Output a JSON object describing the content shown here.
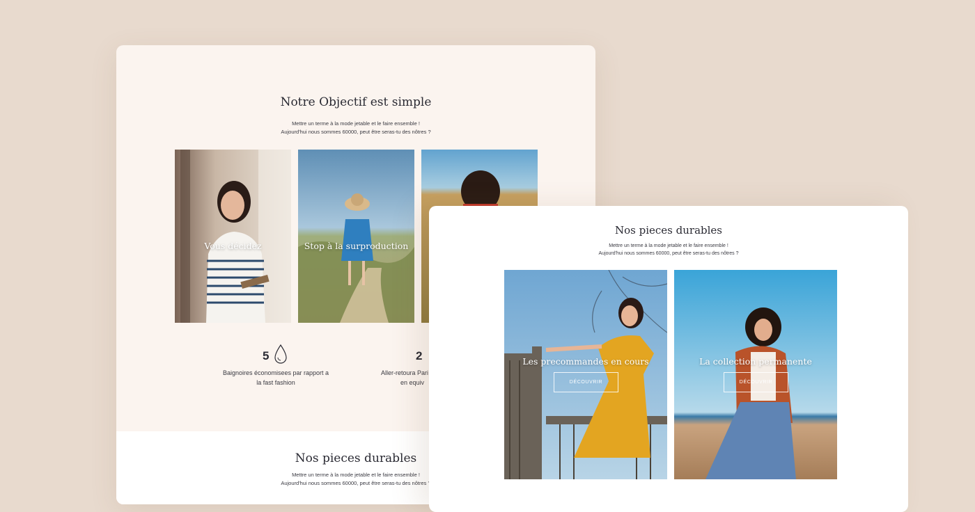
{
  "objective": {
    "title": "Notre Objectif est simple",
    "subtitle_line1": "Mettre un terme à la mode jetable et le faire ensemble !",
    "subtitle_line2": "Aujourd'hui nous sommes 60000, peut être seras-tu des nôtres ?",
    "tiles": [
      {
        "caption": "Vous décidez"
      },
      {
        "caption": "Stop à la surproduction"
      },
      {
        "caption": ""
      }
    ],
    "stats": [
      {
        "number": "5",
        "icon": "water-drop-icon",
        "line1": "Baignoires économisees par rapport a",
        "line2": "la fast fashion"
      },
      {
        "number": "2",
        "line1": "Aller-retoura Pari",
        "line2": "en equiv"
      }
    ]
  },
  "durables_back": {
    "title": "Nos pieces durables",
    "subtitle_line1": "Mettre un terme à la mode jetable et le faire ensemble !",
    "subtitle_line2": "Aujourd'hui nous sommes 60000, peut être seras-tu des nôtres ?"
  },
  "durables_front": {
    "title": "Nos pieces durables",
    "subtitle_line1": "Mettre un terme à la mode jetable et le faire ensemble !",
    "subtitle_line2": "Aujourd'hui nous sommes 60000, peut être seras-tu des nôtres ?",
    "cards": [
      {
        "caption": "Les precommandes en cours",
        "button": "DÉCOUVRIR"
      },
      {
        "caption": "La collection permanente",
        "button": "DÉCOUVRIR"
      }
    ]
  },
  "colors": {
    "background": "#e8dace",
    "card_back": "#fbf4ef",
    "card_front": "#ffffff",
    "text_dark": "#2a2a33"
  }
}
